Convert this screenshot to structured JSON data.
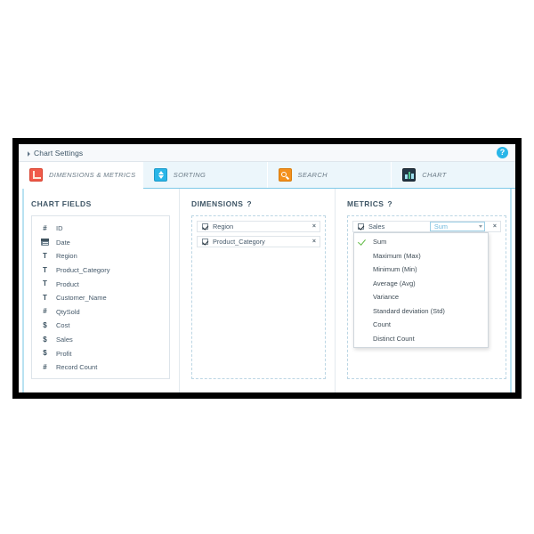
{
  "window": {
    "title": "Chart Settings",
    "collapse_icon": "triangle-collapse-icon",
    "help_icon": "?"
  },
  "tabs": [
    {
      "label": "DIMENSIONS & METRICS",
      "icon": "axes-icon",
      "active": true
    },
    {
      "label": "SORTING",
      "icon": "sort-updown-icon",
      "active": false
    },
    {
      "label": "SEARCH",
      "icon": "magnifier-icon",
      "active": false
    },
    {
      "label": "CHART",
      "icon": "bar-chart-icon",
      "active": false
    }
  ],
  "chart_fields": {
    "heading": "CHART FIELDS",
    "items": [
      {
        "label": "ID",
        "type": "number",
        "glyph": "#"
      },
      {
        "label": "Date",
        "type": "date",
        "glyph": "calendar"
      },
      {
        "label": "Region",
        "type": "text",
        "glyph": "T"
      },
      {
        "label": "Product_Category",
        "type": "text",
        "glyph": "T"
      },
      {
        "label": "Product",
        "type": "text",
        "glyph": "T"
      },
      {
        "label": "Customer_Name",
        "type": "text",
        "glyph": "T"
      },
      {
        "label": "QtySold",
        "type": "number",
        "glyph": "#"
      },
      {
        "label": "Cost",
        "type": "currency",
        "glyph": "$"
      },
      {
        "label": "Sales",
        "type": "currency",
        "glyph": "$"
      },
      {
        "label": "Profit",
        "type": "currency",
        "glyph": "$"
      },
      {
        "label": "Record Count",
        "type": "number",
        "glyph": "#"
      }
    ]
  },
  "dimensions": {
    "heading": "DIMENSIONS",
    "help": "?",
    "items": [
      {
        "label": "Region",
        "checked": true,
        "remove": "×"
      },
      {
        "label": "Product_Category",
        "checked": true,
        "remove": "×"
      }
    ]
  },
  "metrics": {
    "heading": "METRICS",
    "help": "?",
    "items": [
      {
        "label": "Sales",
        "checked": true,
        "aggregation": "Sum",
        "remove": "×"
      }
    ],
    "dropdown": {
      "open": true,
      "selected": "Sum",
      "options": [
        "Sum",
        "Maximum (Max)",
        "Minimum (Min)",
        "Average (Avg)",
        "Variance",
        "Standard deviation (Std)",
        "Count",
        "Distinct Count"
      ]
    }
  },
  "colors": {
    "accent_blue": "#29b6e8",
    "tab_active_bg": "#ffffff",
    "tab_inactive_bg": "#ecf6fb",
    "dim_icon": "#f05b4a",
    "search_icon": "#f3901d",
    "chart_icon": "#243746",
    "check_green": "#62bb46"
  }
}
